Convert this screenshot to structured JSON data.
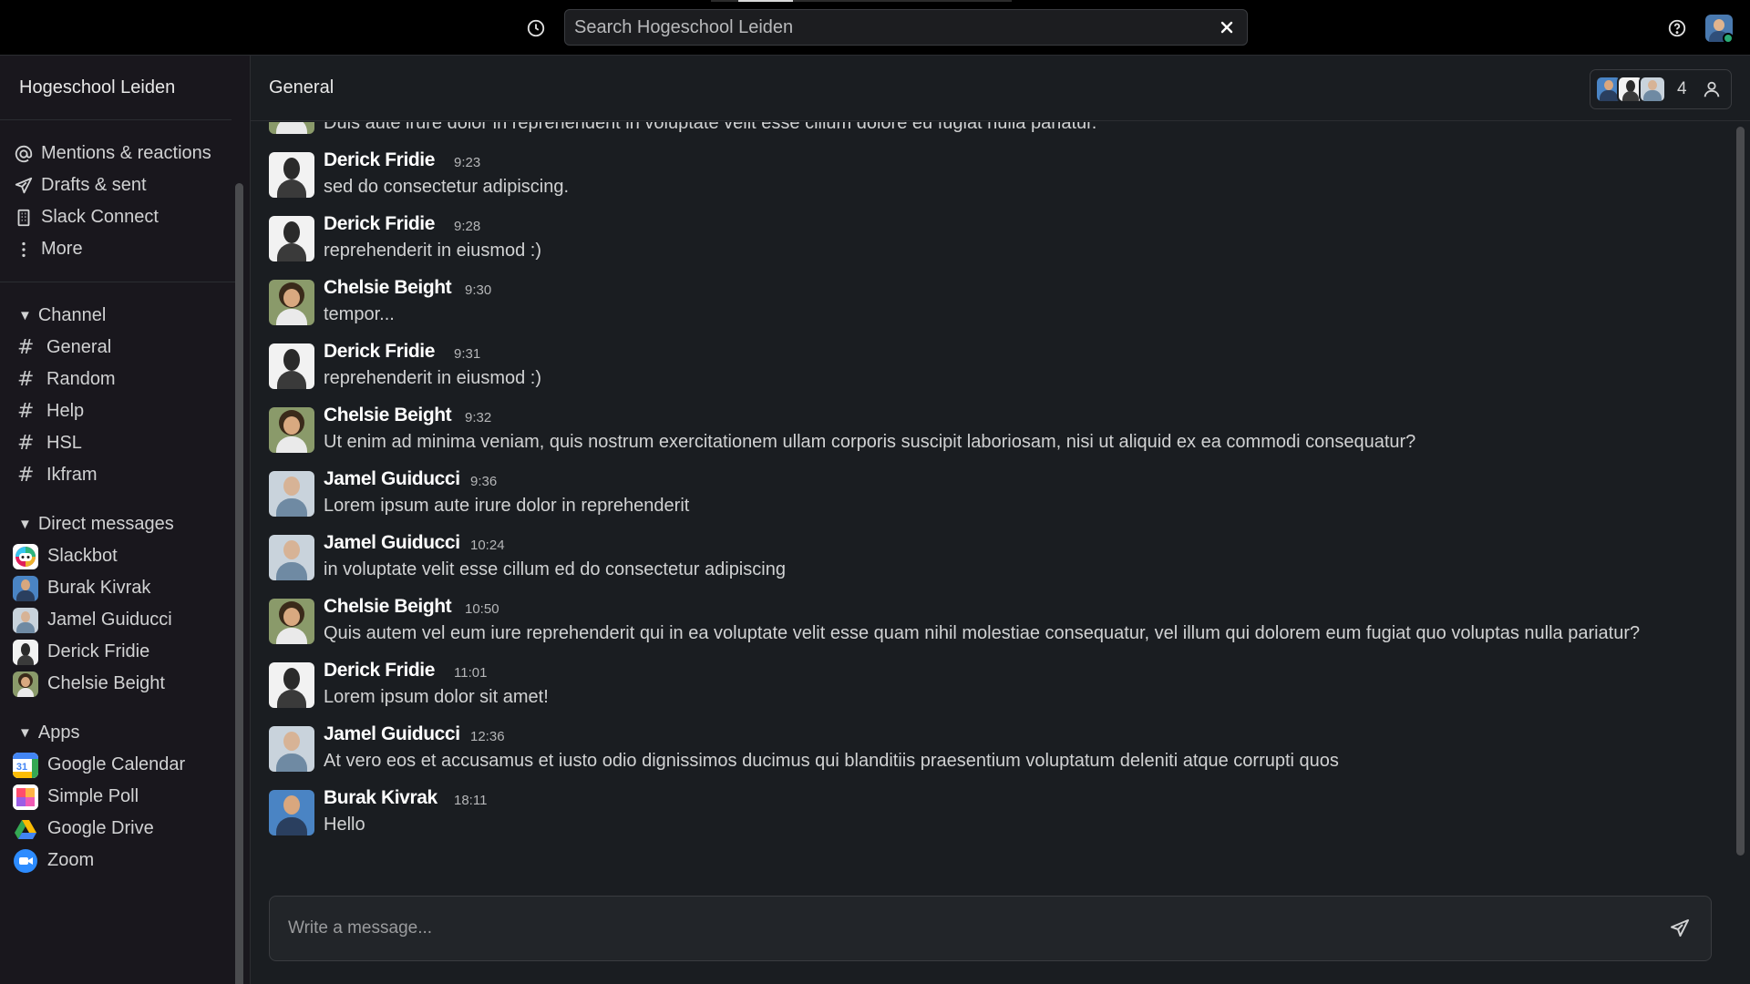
{
  "topbar": {
    "search_placeholder": "Search Hogeschool Leiden",
    "icons": {
      "history": "clock-icon",
      "clear": "close-icon",
      "help": "help-circle-icon"
    }
  },
  "sidebar": {
    "workspace": "Hogeschool Leiden",
    "nav": [
      {
        "label": "Mentions & reactions",
        "icon": "at-icon"
      },
      {
        "label": "Drafts & sent",
        "icon": "send-icon"
      },
      {
        "label": "Slack Connect",
        "icon": "building-icon"
      },
      {
        "label": "More",
        "icon": "more-vertical-icon"
      }
    ],
    "channels_title": "Channel",
    "channels": [
      "General",
      "Random",
      "Help",
      "HSL",
      "Ikfram"
    ],
    "dms_title": "Direct messages",
    "dms": [
      "Slackbot",
      "Burak Kivrak",
      "Jamel Guiducci",
      "Derick Fridie",
      "Chelsie Beight"
    ],
    "apps_title": "Apps",
    "apps": [
      "Google Calendar",
      "Simple Poll",
      "Google Drive",
      "Zoom"
    ]
  },
  "channel": {
    "title": "General",
    "member_count": "4"
  },
  "messages": [
    {
      "author": "",
      "time": "",
      "text": "Duis aute irure dolor in reprehenderit in voluptate velit esse cillum dolore eu fugiat nulla pariatur.",
      "avatar": "chelsie"
    },
    {
      "author": "Derick Fridie",
      "time": "9:23",
      "text": "sed do consectetur adipiscing.",
      "avatar": "derick"
    },
    {
      "author": "Derick Fridie",
      "time": "9:28",
      "text": "reprehenderit in eiusmod :)",
      "avatar": "derick"
    },
    {
      "author": "Chelsie Beight",
      "time": "9:30",
      "text": "tempor...",
      "avatar": "chelsie"
    },
    {
      "author": "Derick Fridie",
      "time": "9:31",
      "text": "reprehenderit in eiusmod :)",
      "avatar": "derick"
    },
    {
      "author": "Chelsie Beight",
      "time": "9:32",
      "text": "Ut enim ad minima veniam, quis nostrum exercitationem ullam corporis suscipit laboriosam, nisi ut aliquid ex ea commodi consequatur?",
      "avatar": "chelsie"
    },
    {
      "author": "Jamel Guiducci",
      "time": "9:36",
      "text": "Lorem ipsum aute irure dolor in reprehenderit",
      "avatar": "jamel"
    },
    {
      "author": "Jamel Guiducci",
      "time": "10:24",
      "text": "in voluptate velit esse cillum ed do consectetur adipiscing",
      "avatar": "jamel"
    },
    {
      "author": "Chelsie Beight",
      "time": "10:50",
      "text": "Quis autem vel eum iure reprehenderit qui in ea voluptate velit esse quam nihil molestiae consequatur, vel illum qui dolorem eum fugiat quo voluptas nulla pariatur?",
      "avatar": "chelsie"
    },
    {
      "author": "Derick Fridie",
      "time": "11:01",
      "text": "Lorem ipsum dolor sit amet!",
      "avatar": "derick"
    },
    {
      "author": "Jamel Guiducci",
      "time": "12:36",
      "text": "At vero eos et accusamus et iusto odio dignissimos ducimus qui blanditiis praesentium voluptatum deleniti atque corrupti quos",
      "avatar": "jamel"
    },
    {
      "author": "Burak Kivrak",
      "time": "18:11",
      "text": "Hello",
      "avatar": "burak"
    }
  ],
  "composer": {
    "placeholder": "Write a message..."
  },
  "colors": {
    "status_online": "#2bac76",
    "background": "#1a1d21",
    "sidebar": "#19171d"
  }
}
